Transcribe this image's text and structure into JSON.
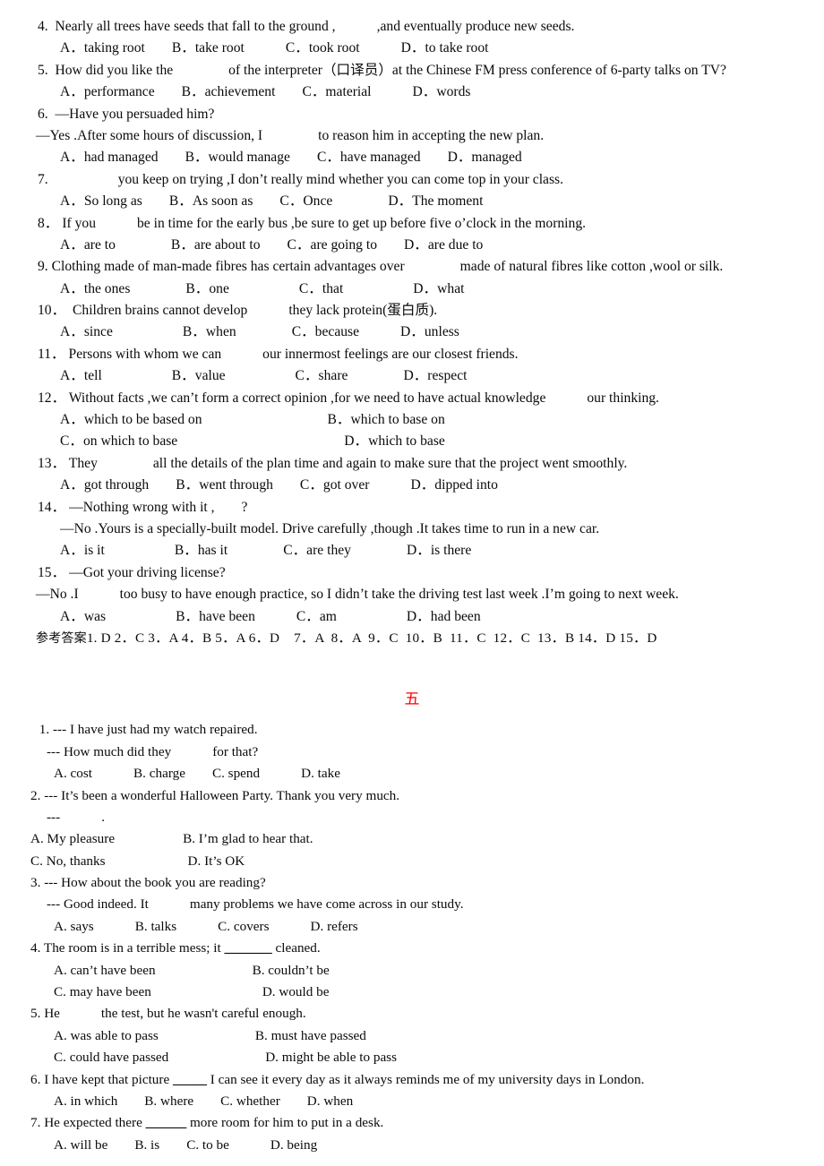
{
  "document": {
    "title": "English grammar multiple-choice worksheet",
    "accent_color": "#ff0000",
    "text_color": "#0a0a0a",
    "background_color": "#ffffff"
  },
  "section_one": {
    "questions": [
      {
        "number": "4.",
        "stem_before": "Nearly all trees have seeds that fall to the ground ,",
        "stem_after": ",and eventually produce new seeds.",
        "options": [
          "A．taking root",
          "B．take root",
          "C．took root",
          "D．to take root"
        ]
      },
      {
        "number": "5.",
        "stem_before": "How did you like the",
        "stem_after": "of the interpreter（口译员）at the Chinese FM press conference of 6-party talks on TV?",
        "options": [
          "A．performance",
          "B．achievement",
          "C．material",
          "D．words"
        ]
      },
      {
        "number": "6.",
        "stem_before": "—Have you persuaded him?",
        "reply_before": "—Yes .After some hours of discussion, I",
        "reply_after": "to reason him in accepting the new plan.",
        "options": [
          "A．had managed",
          "B．would manage",
          "C．have managed",
          "D．managed"
        ]
      },
      {
        "number": "7.",
        "stem_before": "",
        "stem_after": "you keep on trying ,I don’t really mind whether you can come top in your class.",
        "options": [
          "A．So long as",
          "B．As soon as",
          "C．Once",
          "D．The moment"
        ]
      },
      {
        "number": "8．",
        "stem_before": "If you",
        "stem_after": "be in time for the early bus ,be sure to get up before five o’clock in the morning.",
        "options": [
          "A．are to",
          "B．are about to",
          "C．are going to",
          "D．are due to"
        ]
      },
      {
        "number": "9.",
        "stem_before": "Clothing made of man-made fibres has certain advantages over",
        "stem_after": "made of natural fibres like cotton ,wool or silk.",
        "options": [
          "A．the ones",
          "B．one",
          "C．that",
          "D．what"
        ]
      },
      {
        "number": "10．",
        "stem_before": "Children brains cannot develop",
        "stem_after": "they lack protein(蛋白质).",
        "options": [
          "A．since",
          "B．when",
          "C．because",
          "D．unless"
        ]
      },
      {
        "number": "11．",
        "stem_before": "Persons with whom we can",
        "stem_after": "our innermost feelings are our closest friends.",
        "options": [
          "A．tell",
          "B．value",
          "C．share",
          "D．respect"
        ]
      },
      {
        "number": "12．",
        "stem_before": "Without facts ,we can’t form a correct opinion ,for we need to have actual knowledge",
        "stem_after": "our thinking.",
        "options_row1": [
          "A．which to be based on",
          "B．which to base on"
        ],
        "options_row2": [
          "C．on which to base",
          "D．which to base"
        ]
      },
      {
        "number": "13．",
        "stem_before": "They",
        "stem_after": "all the details of the plan time and again to make sure that the project went smoothly.",
        "options": [
          "A．got through",
          "B．went through",
          "C．got over",
          "D．dipped into"
        ]
      },
      {
        "number": "14．",
        "stem_before": "—Nothing wrong with it ,",
        "stem_after": "?",
        "reply": "—No .Yours is a specially-built model. Drive carefully ,though .It takes time to run in a new car.",
        "options": [
          "A．is it",
          "B．has it",
          "C．are they",
          "D．is there"
        ]
      },
      {
        "number": "15．",
        "stem_before": "—Got your driving license?",
        "reply_before": "—No .I",
        "reply_after": "too busy to have enough practice, so I didn’t take the driving test last week .I’m going to next week.",
        "options": [
          "A．was",
          "B．have been",
          "C．am",
          "D．had been"
        ]
      }
    ],
    "answer_key": {
      "label": "参考答案",
      "text": "1. D 2．C 3．A 4．B 5．A 6．D    7．A  8．A  9．C  10．B  11．C  12．C  13．B 14．D 15．D"
    }
  },
  "section_two": {
    "heading": "五",
    "questions": [
      {
        "number": "1.",
        "stem": "--- I have just had my watch repaired.",
        "reply_before": "--- How much did they",
        "reply_after": "for that?",
        "options": [
          "A. cost",
          "B. charge",
          "C. spend",
          "D. take"
        ]
      },
      {
        "number": "2.",
        "stem": "--- It’s been a wonderful Halloween Party. Thank you very much.",
        "reply_before": "---",
        "reply_after": ".",
        "options_row1": [
          "A. My pleasure",
          "B. I’m glad to hear that."
        ],
        "options_row2": [
          "C. No, thanks",
          "D. It’s OK"
        ]
      },
      {
        "number": "3.",
        "stem": "--- How about the book you are reading?",
        "reply_before": "--- Good indeed. It",
        "reply_after": "many problems we have come across in our study.",
        "options": [
          "A. says",
          "B. talks",
          "C. covers",
          "D. refers"
        ]
      },
      {
        "number": "4.",
        "stem_before": "The room is in a terrible mess; it",
        "blank": "_______",
        "stem_after": "cleaned.",
        "options_row1": [
          "A. can’t have been",
          "B. couldn’t be"
        ],
        "options_row2": [
          "C. may have been",
          "D. would be"
        ]
      },
      {
        "number": "5.",
        "stem_before": "He",
        "stem_after": "the test, but he wasn't careful enough.",
        "options_row1": [
          "A. was able to pass",
          "B. must have passed"
        ],
        "options_row2": [
          "C. could have passed",
          "D. might be able to pass"
        ]
      },
      {
        "number": "6.",
        "stem_before": "I have kept that picture",
        "blank": "_____",
        "stem_after": "I can see it every day as it always reminds me of my university days in London.",
        "options": [
          "A. in which",
          "B. where",
          "C. whether",
          "D. when"
        ]
      },
      {
        "number": "7.",
        "stem_before": "He expected there",
        "blank": "______",
        "stem_after": "more room for him to put in a desk.",
        "options": [
          "A. will be",
          "B. is",
          "C. to be",
          "D. being"
        ]
      }
    ]
  }
}
